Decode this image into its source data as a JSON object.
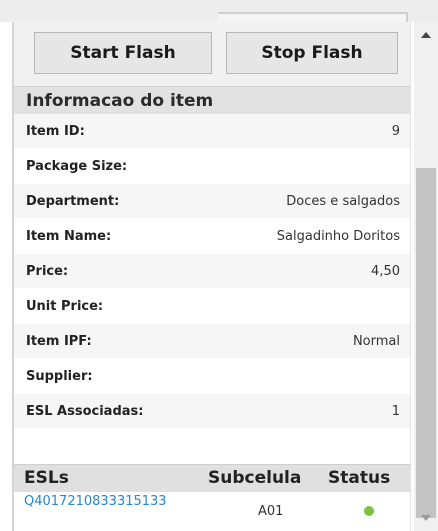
{
  "toolbar": {
    "start_label": "Start Flash",
    "stop_label": "Stop Flash"
  },
  "section": {
    "title": "Informacao do item"
  },
  "fields": [
    {
      "label": "Item ID:",
      "value": "9"
    },
    {
      "label": "Package Size:",
      "value": ""
    },
    {
      "label": "Department:",
      "value": "Doces e salgados"
    },
    {
      "label": "Item Name:",
      "value": "Salgadinho Doritos"
    },
    {
      "label": "Price:",
      "value": "4,50"
    },
    {
      "label": "Unit Price:",
      "value": ""
    },
    {
      "label": "Item IPF:",
      "value": "Normal"
    },
    {
      "label": "Supplier:",
      "value": ""
    },
    {
      "label": "ESL Associadas:",
      "value": "1"
    }
  ],
  "esl_table": {
    "headers": [
      "ESLs",
      "Subcelula",
      "Status"
    ],
    "rows": [
      {
        "esl": "Q4017210833315133",
        "subcelula": "A01",
        "status": "online",
        "status_color": "#7dc242"
      }
    ]
  },
  "icons": {
    "scroll_up": "chevron-up-icon",
    "scroll_down": "chevron-down-icon"
  }
}
